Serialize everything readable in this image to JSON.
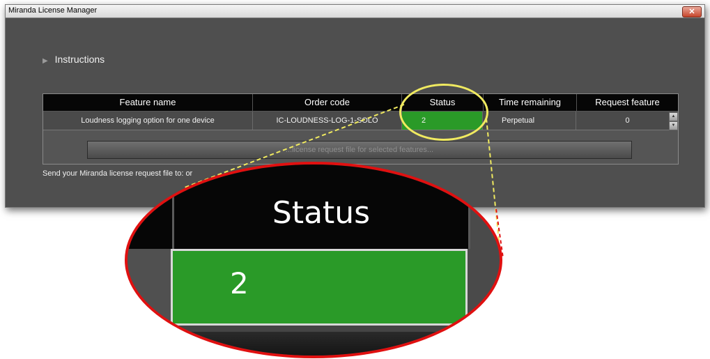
{
  "window": {
    "title": "Miranda License Manager",
    "close_label": "✕"
  },
  "instructions": {
    "label": "Instructions"
  },
  "table": {
    "headers": [
      "Feature name",
      "Order code",
      "Status",
      "Time remaining",
      "Request feature"
    ],
    "rows": [
      {
        "feature_name": "Loudness logging option for one device",
        "order_code": "IC-LOUDNESS-LOG-1-SOLO",
        "status": "2",
        "time_remaining": "Perpetual",
        "request_feature": "0"
      }
    ],
    "status_color": "#2a9a28"
  },
  "generate_button": {
    "label": "...license request file for selected features..."
  },
  "send_text": "Send your Miranda license request file to: or",
  "magnifier": {
    "header": "Status",
    "value": "2",
    "ring_color": "#e01010",
    "callout_color": "#f0ea60"
  }
}
